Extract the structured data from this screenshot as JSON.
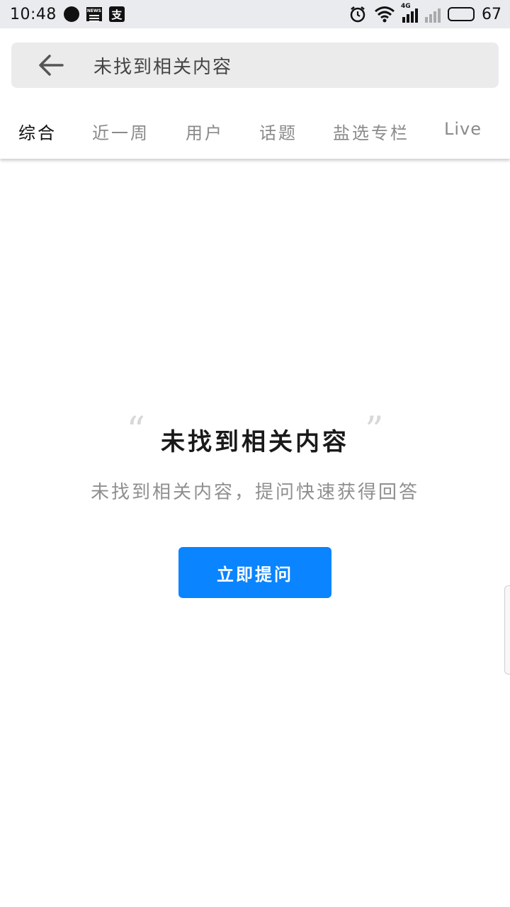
{
  "status_bar": {
    "time": "10:48",
    "news_icon_label": "NEWS",
    "pay_icon_label": "支",
    "network_label": "4G",
    "battery": "67"
  },
  "search": {
    "query": "未找到相关内容"
  },
  "tabs": [
    {
      "label": "综合",
      "active": true
    },
    {
      "label": "近一周",
      "active": false
    },
    {
      "label": "用户",
      "active": false
    },
    {
      "label": "话题",
      "active": false
    },
    {
      "label": "盐选专栏",
      "active": false
    },
    {
      "label": "Live",
      "active": false
    }
  ],
  "empty_state": {
    "title": "未找到相关内容",
    "subtitle": "未找到相关内容，提问快速获得回答",
    "button_label": "立即提问"
  },
  "colors": {
    "accent": "#0a84ff",
    "status_bar_bg": "#e9ebee",
    "search_bg": "#ebebeb"
  }
}
